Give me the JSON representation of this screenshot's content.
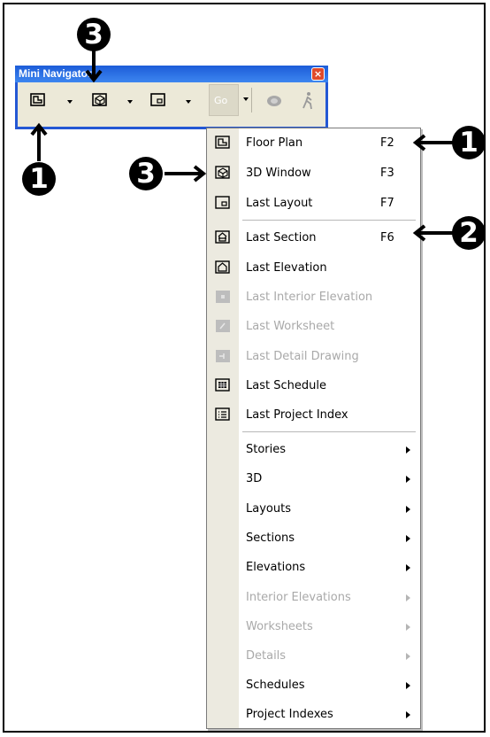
{
  "window": {
    "title": "Mini Navigator",
    "close_glyph": "×",
    "go_label": "Go"
  },
  "toolbar": {
    "buttons": [
      {
        "icon": "floor-plan-icon"
      },
      {
        "icon": "3d-window-icon"
      },
      {
        "icon": "layout-icon"
      },
      {
        "icon": "go-button"
      },
      {
        "icon": "orbit-icon"
      },
      {
        "icon": "walk-icon"
      }
    ]
  },
  "menu": {
    "items": [
      {
        "label": "Floor Plan",
        "shortcut": "F2",
        "icon": "floor-plan-icon",
        "enabled": true
      },
      {
        "label": "3D Window",
        "shortcut": "F3",
        "icon": "3d-window-icon",
        "enabled": true
      },
      {
        "label": "Last Layout",
        "shortcut": "F7",
        "icon": "layout-icon",
        "enabled": true
      },
      {
        "label": "Last Section",
        "shortcut": "F6",
        "icon": "section-icon",
        "enabled": true
      },
      {
        "label": "Last Elevation",
        "shortcut": "",
        "icon": "elevation-icon",
        "enabled": true
      },
      {
        "label": "Last Interior Elevation",
        "shortcut": "",
        "icon": "interior-elevation-icon",
        "enabled": false
      },
      {
        "label": "Last Worksheet",
        "shortcut": "",
        "icon": "worksheet-icon",
        "enabled": false
      },
      {
        "label": "Last Detail Drawing",
        "shortcut": "",
        "icon": "detail-drawing-icon",
        "enabled": false
      },
      {
        "label": "Last Schedule",
        "shortcut": "",
        "icon": "schedule-icon",
        "enabled": true
      },
      {
        "label": "Last Project Index",
        "shortcut": "",
        "icon": "project-index-icon",
        "enabled": true
      }
    ],
    "submenus": [
      {
        "label": "Stories",
        "enabled": true
      },
      {
        "label": "3D",
        "enabled": true
      },
      {
        "label": "Layouts",
        "enabled": true
      },
      {
        "label": "Sections",
        "enabled": true
      },
      {
        "label": "Elevations",
        "enabled": true
      },
      {
        "label": "Interior Elevations",
        "enabled": false
      },
      {
        "label": "Worksheets",
        "enabled": false
      },
      {
        "label": "Details",
        "enabled": false
      },
      {
        "label": "Schedules",
        "enabled": true
      },
      {
        "label": "Project Indexes",
        "enabled": true
      }
    ]
  },
  "callouts": [
    "3",
    "1",
    "3",
    "1",
    "2"
  ],
  "colors": {
    "title_bar": "#2458d4",
    "close": "#e04a2a",
    "toolbar_bg": "#ece9d8",
    "disabled": "#a9a9a9"
  }
}
